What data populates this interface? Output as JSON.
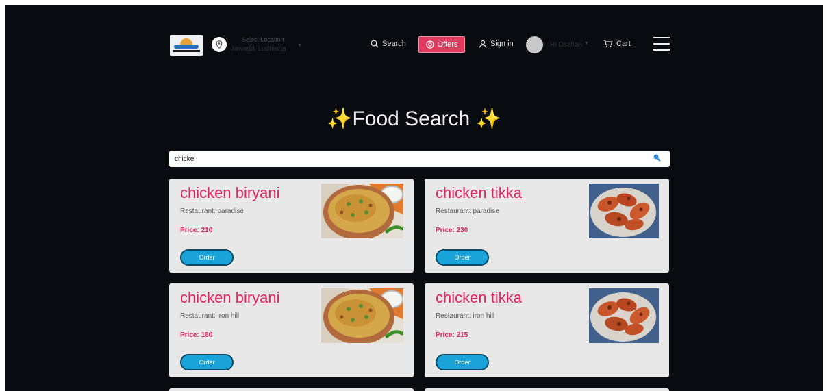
{
  "navbar": {
    "location_label": "Select Location",
    "location_value": "Jawaddi Ludhiana",
    "search_label": "Search",
    "offers_label": "Offers",
    "signin_label": "Sign in",
    "user_label": "Hi Osahan",
    "cart_label": "Cart"
  },
  "page_title": "Food Search",
  "search": {
    "value": "chicke"
  },
  "colors": {
    "accent": "#e0245e",
    "order_button": "#1aa3d9",
    "offers_button": "#e23a5e",
    "background": "#080b10"
  },
  "results": [
    {
      "name": "chicken biryani",
      "restaurant": "Restaurant: paradise",
      "price": "Price: 210",
      "order_label": "Order"
    },
    {
      "name": "chicken tikka",
      "restaurant": "Restaurant: paradise",
      "price": "Price: 230",
      "order_label": "Order"
    },
    {
      "name": "chicken biryani",
      "restaurant": "Restaurant: iron hill",
      "price": "Price: 180",
      "order_label": "Order"
    },
    {
      "name": "chicken tikka",
      "restaurant": "Restaurant: iron hill",
      "price": "Price: 215",
      "order_label": "Order"
    }
  ]
}
